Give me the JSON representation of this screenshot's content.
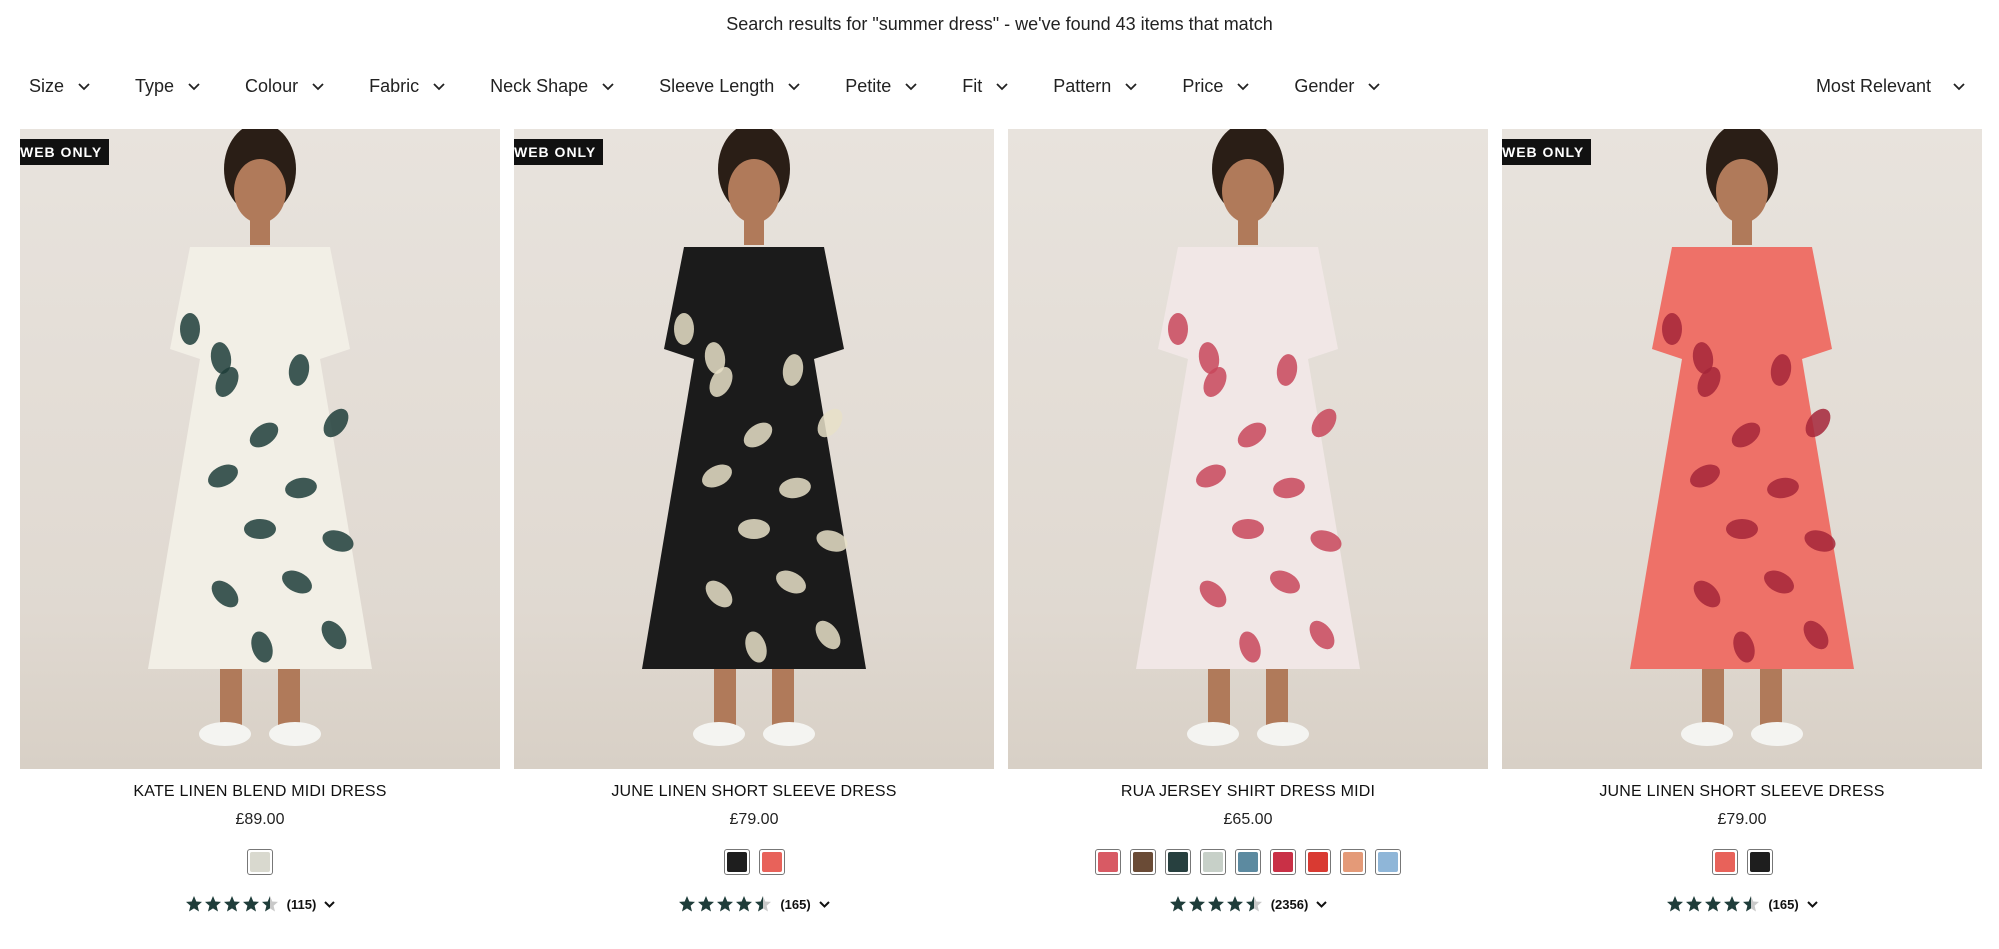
{
  "search": {
    "summary": "Search results for \"summer dress\" - we've found 43 items that match"
  },
  "filters": [
    {
      "label": "Size"
    },
    {
      "label": "Type"
    },
    {
      "label": "Colour"
    },
    {
      "label": "Fabric"
    },
    {
      "label": "Neck Shape"
    },
    {
      "label": "Sleeve Length"
    },
    {
      "label": "Petite"
    },
    {
      "label": "Fit"
    },
    {
      "label": "Pattern"
    },
    {
      "label": "Price"
    },
    {
      "label": "Gender"
    }
  ],
  "sort": {
    "label": "Most Relevant"
  },
  "colors": {
    "star": "#1f3d3a",
    "badge_bg": "#111111"
  },
  "products": [
    {
      "badge": "WEB ONLY",
      "name": "KATE LINEN BLEND MIDI DRESS",
      "price": "£89.00",
      "dress_color": "#f2efe6",
      "pattern_color": "#1f3d3a",
      "swatches": [
        "#d9d9cf"
      ],
      "rating": 4.5,
      "reviews": "(115)"
    },
    {
      "badge": "WEB ONLY",
      "name": "JUNE LINEN SHORT SLEEVE DRESS",
      "price": "£79.00",
      "dress_color": "#1b1b1b",
      "pattern_color": "#e8e0c8",
      "swatches": [
        "#1e1e1e",
        "#e8625a"
      ],
      "rating": 4.5,
      "reviews": "(165)"
    },
    {
      "badge": "",
      "name": "RUA JERSEY SHIRT DRESS MIDI",
      "price": "£65.00",
      "dress_color": "#f1e7e6",
      "pattern_color": "#c8475a",
      "swatches": [
        "#d85a64",
        "#6a4b36",
        "#27403f",
        "#c7d0c8",
        "#5c8aa0",
        "#c93046",
        "#d93a32",
        "#e49a78",
        "#8fb6d8"
      ],
      "rating": 4.5,
      "reviews": "(2356)"
    },
    {
      "badge": "WEB ONLY",
      "name": "JUNE LINEN SHORT SLEEVE DRESS",
      "price": "£79.00",
      "dress_color": "#ee7168",
      "pattern_color": "#a5263a",
      "swatches": [
        "#e8625a",
        "#1e1e1e"
      ],
      "rating": 4.5,
      "reviews": "(165)"
    }
  ]
}
